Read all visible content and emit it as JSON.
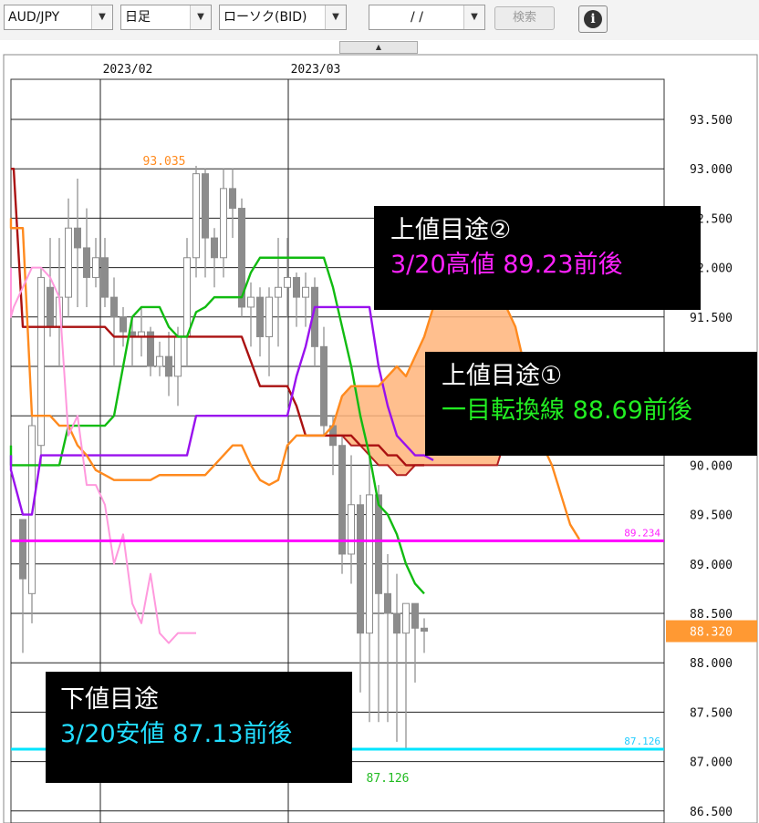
{
  "toolbar": {
    "symbol": "AUD/JPY",
    "period": "日足",
    "chart_type": "ローソク(BID)",
    "date": "/  /",
    "search_label": "検索",
    "info_icon": "i"
  },
  "chart_data": {
    "type": "candlestick",
    "x_labels": [
      "2023/02",
      "2023/03"
    ],
    "y_ticks": [
      "86.500",
      "87.000",
      "87.500",
      "88.000",
      "88.500",
      "89.000",
      "89.500",
      "90.000",
      "90.500",
      "91.000",
      "91.500",
      "92.000",
      "92.500",
      "93.000",
      "93.500"
    ],
    "current_price": "88.320",
    "annotations": {
      "high_label": "93.035",
      "low_label": "87.126",
      "line_upper": "89.234",
      "line_lower": "87.126"
    },
    "horizontal_lines": [
      {
        "value": 89.234,
        "color": "#ff00ff"
      },
      {
        "value": 87.126,
        "color": "#00e5ff"
      }
    ],
    "candles": [
      [
        89.45,
        88.85,
        88.1,
        89.4
      ],
      [
        88.7,
        90.4,
        88.4,
        90.5
      ],
      [
        90.2,
        91.9,
        90.0,
        92.0
      ],
      [
        91.8,
        91.4,
        91.3,
        92.3
      ],
      [
        91.4,
        91.7,
        91.0,
        92.3
      ],
      [
        91.7,
        92.4,
        91.5,
        92.7
      ],
      [
        92.4,
        92.2,
        91.6,
        92.9
      ],
      [
        92.2,
        91.9,
        91.6,
        92.6
      ],
      [
        91.9,
        92.1,
        91.8,
        92.3
      ],
      [
        92.1,
        91.7,
        91.6,
        92.3
      ],
      [
        91.7,
        91.5,
        91.0,
        91.9
      ],
      [
        91.5,
        91.35,
        91.2,
        91.6
      ],
      [
        91.35,
        91.3,
        91.0,
        91.5
      ],
      [
        91.3,
        91.35,
        91.1,
        91.6
      ],
      [
        91.35,
        91.0,
        90.9,
        91.4
      ],
      [
        91.0,
        91.1,
        90.9,
        91.25
      ],
      [
        91.1,
        90.9,
        90.7,
        91.35
      ],
      [
        90.9,
        91.3,
        90.6,
        91.4
      ],
      [
        91.3,
        92.1,
        91.0,
        92.3
      ],
      [
        92.1,
        92.95,
        91.9,
        93.03
      ],
      [
        92.95,
        92.3,
        91.9,
        93.0
      ],
      [
        92.3,
        92.1,
        91.8,
        92.4
      ],
      [
        92.1,
        92.8,
        91.9,
        93.0
      ],
      [
        92.8,
        92.6,
        92.3,
        93.0
      ],
      [
        92.6,
        91.6,
        91.5,
        92.7
      ],
      [
        91.6,
        91.7,
        91.2,
        91.85
      ],
      [
        91.7,
        91.3,
        91.1,
        91.8
      ],
      [
        91.3,
        91.7,
        90.9,
        91.8
      ],
      [
        91.7,
        91.8,
        91.2,
        92.3
      ],
      [
        91.8,
        91.9,
        91.5,
        92.3
      ],
      [
        91.9,
        91.7,
        91.4,
        91.95
      ],
      [
        91.7,
        91.8,
        91.4,
        91.95
      ],
      [
        91.8,
        91.2,
        91.0,
        91.9
      ],
      [
        91.2,
        90.4,
        90.3,
        91.4
      ],
      [
        90.4,
        90.2,
        89.9,
        90.5
      ],
      [
        90.2,
        89.1,
        88.9,
        90.3
      ],
      [
        89.1,
        89.6,
        88.8,
        90.1
      ],
      [
        89.6,
        88.3,
        87.7,
        89.7
      ],
      [
        88.3,
        89.7,
        87.4,
        90.1
      ],
      [
        89.7,
        88.7,
        87.4,
        89.8
      ],
      [
        88.7,
        88.5,
        87.4,
        89.1
      ],
      [
        88.5,
        88.3,
        87.2,
        88.9
      ],
      [
        88.3,
        88.6,
        87.13,
        88.6
      ],
      [
        88.6,
        88.35,
        87.8,
        88.5
      ],
      [
        88.35,
        88.32,
        88.1,
        88.45
      ]
    ],
    "series": [
      {
        "color": "#aa1111",
        "values": [
          [
            0,
            91.4
          ],
          [
            1,
            91.4
          ],
          [
            2,
            91.4
          ],
          [
            3,
            91.4
          ],
          [
            4,
            91.4
          ],
          [
            5,
            91.4
          ],
          [
            6,
            91.4
          ],
          [
            7,
            91.4
          ],
          [
            8,
            91.4
          ],
          [
            9,
            91.4
          ],
          [
            10,
            91.3
          ],
          [
            11,
            91.3
          ],
          [
            12,
            91.3
          ],
          [
            13,
            91.3
          ],
          [
            14,
            91.3
          ],
          [
            15,
            91.3
          ],
          [
            16,
            91.3
          ],
          [
            17,
            91.3
          ],
          [
            18,
            91.3
          ],
          [
            19,
            91.3
          ],
          [
            20,
            91.3
          ],
          [
            21,
            91.3
          ],
          [
            22,
            91.3
          ],
          [
            23,
            91.3
          ],
          [
            24,
            91.3
          ],
          [
            25,
            91.05
          ],
          [
            26,
            90.8
          ],
          [
            27,
            90.8
          ],
          [
            28,
            90.8
          ],
          [
            29,
            90.8
          ],
          [
            30,
            90.6
          ],
          [
            31,
            90.3
          ],
          [
            32,
            90.3
          ],
          [
            33,
            90.3
          ],
          [
            34,
            90.3
          ],
          [
            35,
            90.3
          ],
          [
            36,
            90.3
          ],
          [
            37,
            90.2
          ],
          [
            38,
            90.2
          ],
          [
            39,
            90.2
          ],
          [
            40,
            90.1
          ],
          [
            41,
            90.1
          ],
          [
            42,
            90.0
          ],
          [
            43,
            90.0
          ],
          [
            44,
            90.0
          ]
        ],
        "pre": [
          [
            -4,
            93.0
          ],
          [
            -1,
            93.0
          ],
          [
            0,
            91.4
          ]
        ]
      },
      {
        "color": "#11bb11",
        "values": [
          [
            0,
            90.0
          ],
          [
            1,
            90.0
          ],
          [
            2,
            90.0
          ],
          [
            3,
            90.0
          ],
          [
            4,
            90.0
          ],
          [
            5,
            90.4
          ],
          [
            6,
            90.4
          ],
          [
            7,
            90.4
          ],
          [
            8,
            90.4
          ],
          [
            9,
            90.4
          ],
          [
            10,
            90.5
          ],
          [
            11,
            91.0
          ],
          [
            12,
            91.5
          ],
          [
            13,
            91.6
          ],
          [
            14,
            91.6
          ],
          [
            15,
            91.6
          ],
          [
            16,
            91.4
          ],
          [
            17,
            91.3
          ],
          [
            18,
            91.3
          ],
          [
            19,
            91.55
          ],
          [
            20,
            91.6
          ],
          [
            21,
            91.7
          ],
          [
            22,
            91.7
          ],
          [
            23,
            91.7
          ],
          [
            24,
            91.7
          ],
          [
            25,
            91.95
          ],
          [
            26,
            92.1
          ],
          [
            27,
            92.1
          ],
          [
            28,
            92.1
          ],
          [
            29,
            92.1
          ],
          [
            30,
            92.1
          ],
          [
            31,
            92.1
          ],
          [
            32,
            92.1
          ],
          [
            33,
            92.1
          ],
          [
            34,
            91.8
          ],
          [
            35,
            91.4
          ],
          [
            36,
            91.0
          ],
          [
            37,
            90.5
          ],
          [
            38,
            90.1
          ],
          [
            39,
            89.6
          ],
          [
            40,
            89.5
          ],
          [
            41,
            89.3
          ],
          [
            42,
            89.0
          ],
          [
            43,
            88.8
          ],
          [
            44,
            88.7
          ]
        ],
        "pre": [
          [
            -4,
            90.2
          ],
          [
            -3,
            90.0
          ],
          [
            0,
            90.0
          ]
        ]
      },
      {
        "color": "#9911ee",
        "values": [
          [
            0,
            89.5
          ],
          [
            1,
            89.5
          ],
          [
            2,
            90.1
          ],
          [
            3,
            90.1
          ],
          [
            4,
            90.1
          ],
          [
            5,
            90.1
          ],
          [
            6,
            90.1
          ],
          [
            7,
            90.1
          ],
          [
            8,
            90.1
          ],
          [
            9,
            90.1
          ],
          [
            10,
            90.1
          ],
          [
            11,
            90.1
          ],
          [
            12,
            90.1
          ],
          [
            13,
            90.1
          ],
          [
            14,
            90.1
          ],
          [
            15,
            90.1
          ],
          [
            16,
            90.1
          ],
          [
            17,
            90.1
          ],
          [
            18,
            90.1
          ],
          [
            19,
            90.5
          ],
          [
            20,
            90.5
          ],
          [
            21,
            90.5
          ],
          [
            22,
            90.5
          ],
          [
            23,
            90.5
          ],
          [
            24,
            90.5
          ],
          [
            25,
            90.5
          ],
          [
            26,
            90.5
          ],
          [
            27,
            90.5
          ],
          [
            28,
            90.5
          ],
          [
            29,
            90.5
          ],
          [
            30,
            90.9
          ],
          [
            31,
            91.2
          ],
          [
            32,
            91.6
          ],
          [
            33,
            91.6
          ],
          [
            34,
            91.6
          ],
          [
            35,
            91.6
          ],
          [
            36,
            91.6
          ],
          [
            37,
            91.6
          ],
          [
            38,
            91.6
          ],
          [
            39,
            91.0
          ],
          [
            40,
            90.6
          ],
          [
            41,
            90.3
          ],
          [
            42,
            90.2
          ],
          [
            43,
            90.1
          ],
          [
            44,
            90.1
          ],
          [
            45,
            90.05
          ]
        ],
        "pre": [
          [
            -4,
            90.1
          ],
          [
            -2,
            89.95
          ],
          [
            0,
            89.5
          ]
        ]
      },
      {
        "color": "#ff8a1e",
        "values": [
          [
            0,
            92.4
          ],
          [
            1,
            90.5
          ],
          [
            2,
            90.5
          ],
          [
            3,
            90.5
          ],
          [
            4,
            90.4
          ],
          [
            5,
            90.4
          ],
          [
            6,
            90.2
          ],
          [
            7,
            90.1
          ],
          [
            8,
            89.95
          ],
          [
            9,
            89.9
          ],
          [
            10,
            89.85
          ],
          [
            11,
            89.85
          ],
          [
            12,
            89.85
          ],
          [
            13,
            89.85
          ],
          [
            14,
            89.85
          ],
          [
            15,
            89.9
          ],
          [
            16,
            89.9
          ],
          [
            17,
            89.9
          ],
          [
            18,
            89.9
          ],
          [
            19,
            89.9
          ],
          [
            20,
            89.9
          ],
          [
            21,
            90.0
          ],
          [
            22,
            90.1
          ],
          [
            23,
            90.2
          ],
          [
            24,
            90.2
          ],
          [
            25,
            90.0
          ],
          [
            26,
            89.85
          ],
          [
            27,
            89.8
          ],
          [
            28,
            89.85
          ],
          [
            29,
            90.2
          ],
          [
            30,
            90.3
          ],
          [
            31,
            90.3
          ],
          [
            32,
            90.3
          ],
          [
            33,
            90.3
          ],
          [
            34,
            90.4
          ],
          [
            35,
            90.7
          ],
          [
            36,
            90.8
          ],
          [
            37,
            90.8
          ],
          [
            38,
            90.8
          ],
          [
            39,
            90.8
          ],
          [
            40,
            90.9
          ],
          [
            41,
            91.0
          ],
          [
            42,
            90.9
          ],
          [
            43,
            91.1
          ],
          [
            44,
            91.3
          ],
          [
            45,
            91.6
          ],
          [
            46,
            91.8
          ],
          [
            47,
            91.8
          ],
          [
            48,
            91.8
          ],
          [
            49,
            91.9
          ],
          [
            50,
            91.85
          ],
          [
            51,
            91.8
          ],
          [
            52,
            91.75
          ],
          [
            53,
            91.6
          ],
          [
            54,
            91.4
          ],
          [
            55,
            91.0
          ],
          [
            56,
            90.6
          ],
          [
            57,
            90.2
          ],
          [
            58,
            90.0
          ],
          [
            59,
            89.7
          ],
          [
            60,
            89.4
          ],
          [
            61,
            89.25
          ]
        ],
        "pre": [
          [
            -4,
            92.5
          ],
          [
            -2,
            92.4
          ],
          [
            0,
            92.4
          ]
        ]
      },
      {
        "color": "#ff99dd",
        "values": [
          [
            -4,
            92.0
          ],
          [
            -3,
            91.7
          ],
          [
            -2,
            91.5
          ],
          [
            -1,
            91.6
          ],
          [
            0,
            91.8
          ],
          [
            1,
            92.0
          ],
          [
            2,
            92.0
          ],
          [
            3,
            91.9
          ],
          [
            4,
            91.7
          ],
          [
            5,
            90.3
          ],
          [
            6,
            90.5
          ],
          [
            7,
            89.8
          ],
          [
            8,
            89.8
          ],
          [
            9,
            89.6
          ],
          [
            10,
            89.0
          ],
          [
            11,
            89.3
          ],
          [
            12,
            88.6
          ],
          [
            13,
            88.4
          ],
          [
            14,
            88.9
          ],
          [
            15,
            88.3
          ],
          [
            16,
            88.2
          ],
          [
            17,
            88.3
          ],
          [
            18,
            88.3
          ],
          [
            19,
            88.3
          ]
        ],
        "pre": []
      }
    ],
    "kumo_span_b": [
      [
        33,
        90.3
      ],
      [
        34,
        90.3
      ],
      [
        35,
        90.3
      ],
      [
        36,
        90.2
      ],
      [
        37,
        90.2
      ],
      [
        38,
        90.1
      ],
      [
        39,
        90.0
      ],
      [
        40,
        90.0
      ],
      [
        41,
        89.9
      ],
      [
        42,
        89.9
      ],
      [
        43,
        90.0
      ],
      [
        44,
        90.0
      ],
      [
        45,
        90.0
      ],
      [
        46,
        90.0
      ],
      [
        47,
        90.0
      ],
      [
        48,
        90.0
      ],
      [
        49,
        90.0
      ],
      [
        50,
        90.0
      ],
      [
        51,
        90.0
      ],
      [
        52,
        90.0
      ],
      [
        53,
        90.3
      ],
      [
        54,
        90.6
      ],
      [
        55,
        90.8
      ],
      [
        56,
        90.8
      ],
      [
        57,
        90.8
      ],
      [
        58,
        90.8
      ],
      [
        59,
        90.7
      ],
      [
        60,
        90.6
      ],
      [
        61,
        90.1
      ]
    ]
  },
  "labels": {
    "upper2_title": "上値目途②",
    "upper2_detail": "3/20高値  89.23前後",
    "upper1_title": "上値目途①",
    "upper1_detail": "一目転換線  88.69前後",
    "lower_title": "下値目途",
    "lower_detail": "3/20安値  87.13前後"
  },
  "colors": {
    "upper2_detail": "#ff22ff",
    "upper1_detail": "#22ee22",
    "lower_detail": "#22ddff",
    "current_price_bg": "#ff9933"
  }
}
